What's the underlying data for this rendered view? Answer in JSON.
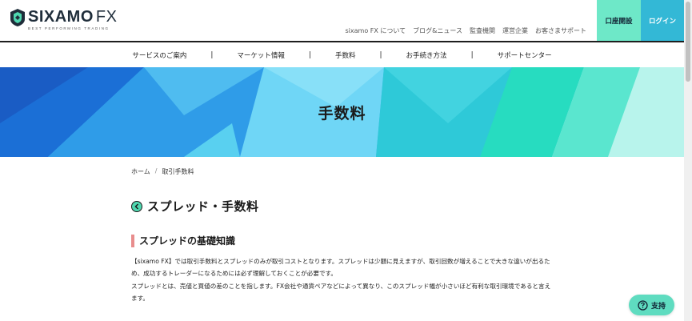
{
  "header": {
    "logo_text": "SIXAMO",
    "logo_fx": "FX",
    "logo_sub": "BEST PERFORMING TRADING",
    "top_links": [
      "sixamo FX について",
      "ブログ&ニュース",
      "監査機関",
      "運営企業",
      "お客さまサポート"
    ],
    "account_button": "口座開設",
    "login_button": "ログイン"
  },
  "nav": {
    "items": [
      "サービスのご案内",
      "マーケット情報",
      "手数料",
      "お手続き方法",
      "サポートセンター"
    ],
    "separator": "|"
  },
  "hero": {
    "title": "手数料"
  },
  "breadcrumb": {
    "home": "ホーム",
    "separator": "/",
    "current": "取引手数料"
  },
  "main": {
    "page_title": "スプレッド・手数料",
    "section_title": "スプレッドの基礎知識",
    "paragraph1": "【sixamo FX】では取引手数料とスプレッドのみが取引コストとなります。スプレッドは少額に見えますが、取引回数が増えることで大きな違いが出るため、成功するトレーダーになるためには必ず理解しておくことが必要です。",
    "paragraph2": "スプレッドとは、売値と買値の差のことを指します。FX会社や通貨ペアなどによって異なり、このスプレッド幅が小さいほど有利な取引環境であると言えます。"
  },
  "support": {
    "label": "支持"
  },
  "colors": {
    "accent_green": "#6ee8c8",
    "accent_blue": "#33b8d6",
    "section_marker": "#e88d8d"
  }
}
